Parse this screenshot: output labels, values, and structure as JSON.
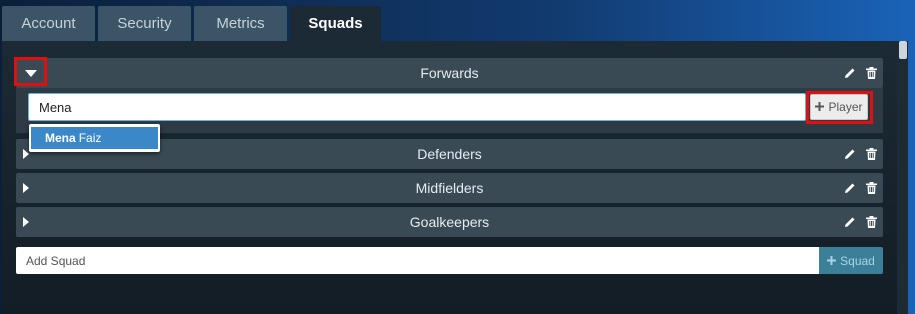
{
  "tabs": [
    {
      "label": "Account",
      "active": false
    },
    {
      "label": "Security",
      "active": false
    },
    {
      "label": "Metrics",
      "active": false
    },
    {
      "label": "Squads",
      "active": true
    }
  ],
  "squads": [
    {
      "name": "Forwards",
      "expanded": true
    },
    {
      "name": "Defenders",
      "expanded": false
    },
    {
      "name": "Midfielders",
      "expanded": false
    },
    {
      "name": "Goalkeepers",
      "expanded": false
    }
  ],
  "player_search": {
    "value": "Mena",
    "add_button_label": "Player",
    "add_button_icon": "plus-icon"
  },
  "suggestion": {
    "match": "Mena",
    "rest": "Faiz"
  },
  "add_squad": {
    "placeholder": "Add Squad",
    "button_label": "Squad",
    "button_icon": "plus-icon"
  },
  "icons": {
    "edit": "pencil-icon",
    "delete": "trash-icon",
    "expand": "caret-icon"
  },
  "colors": {
    "highlight": "#e01010",
    "active_tab": "#1b2a35",
    "inactive_tab": "#3b5566",
    "suggestion_bg": "#3b88c9",
    "squad_button": "#3b7f99"
  }
}
